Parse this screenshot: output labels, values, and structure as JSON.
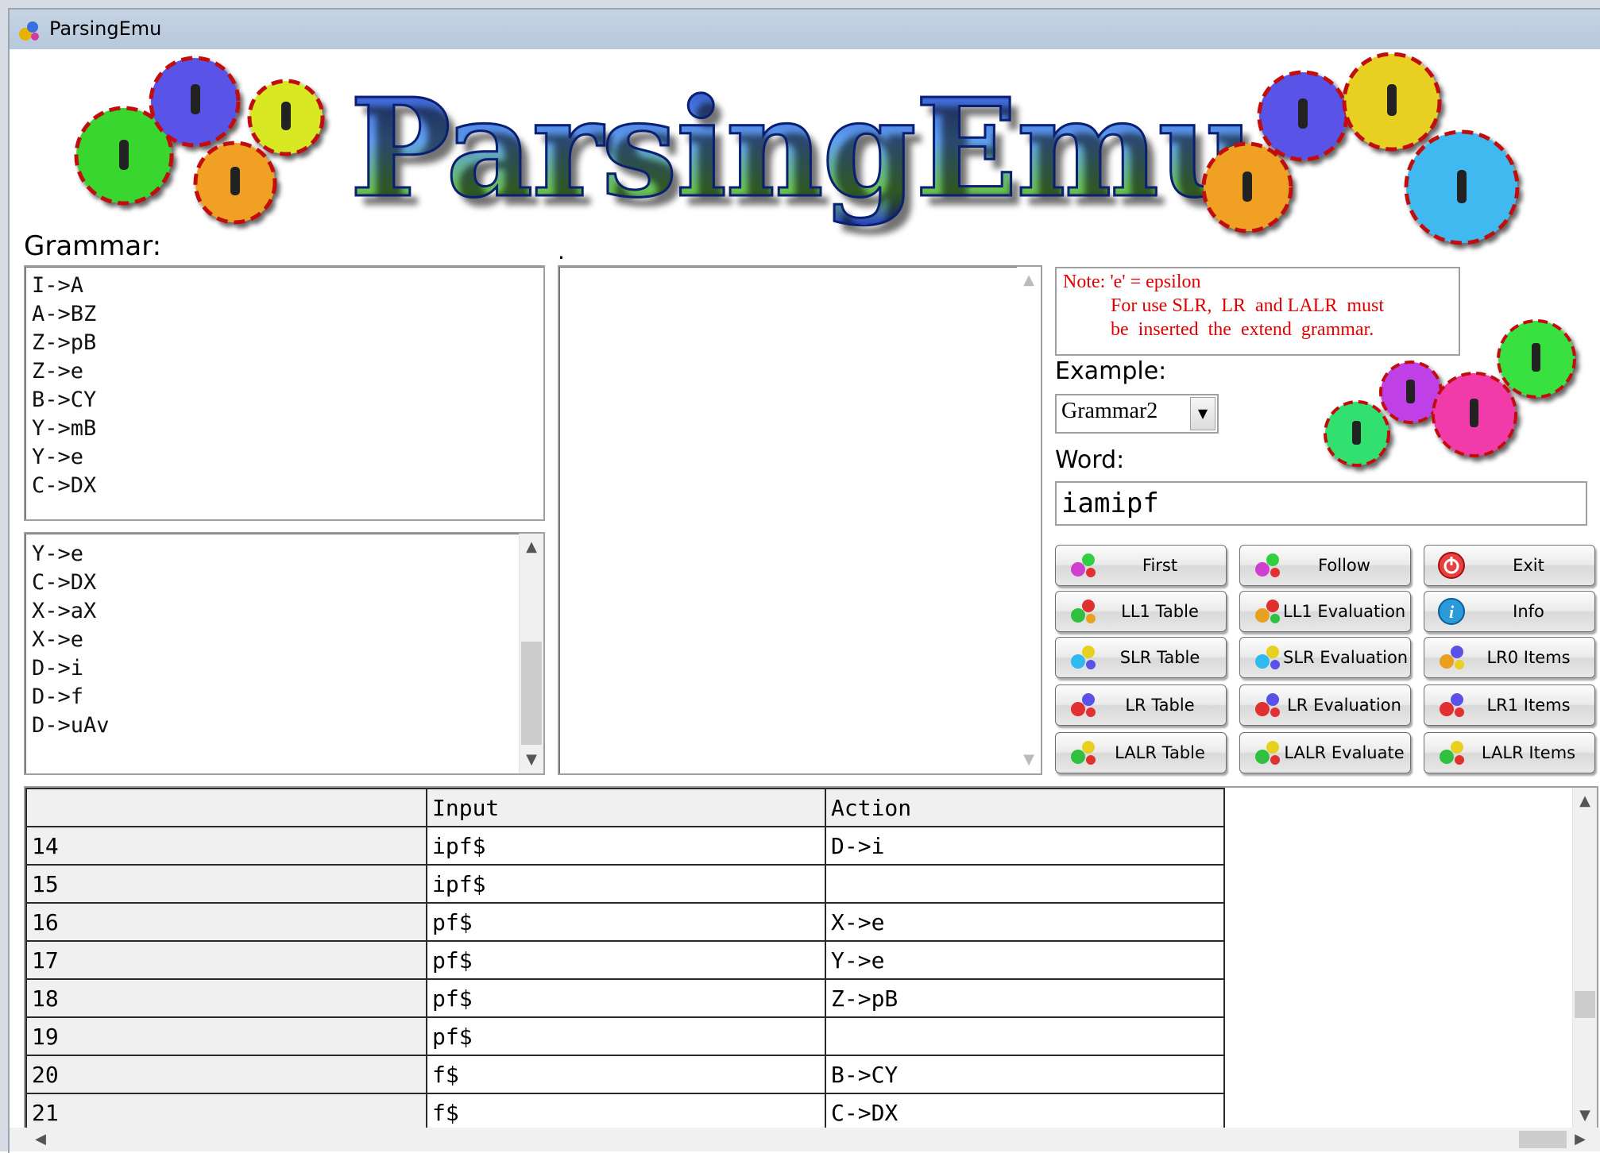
{
  "window": {
    "title": "ParsingEmu"
  },
  "banner": {
    "title": "ParsingEmu"
  },
  "grammar": {
    "label": "Grammar:",
    "top_lines": [
      "I->A",
      "A->BZ",
      "Z->pB",
      "Z->e",
      "B->CY",
      "Y->mB",
      "Y->e",
      "C->DX"
    ],
    "bottom_lines": [
      "Y->e",
      "C->DX",
      "X->aX",
      "X->e",
      "D->i",
      "D->f",
      "D->uAv"
    ]
  },
  "middle": {
    "label": "."
  },
  "note": {
    "line1": "Note: 'e' = epsilon",
    "line2": "For use SLR,  LR  and LALR  must",
    "line3": "be  inserted  the  extend  grammar."
  },
  "example": {
    "label": "Example:",
    "value": "Grammar2"
  },
  "word": {
    "label": "Word:",
    "value": "iamipf"
  },
  "buttons": {
    "first": "First",
    "follow": "Follow",
    "exit": "Exit",
    "ll1_table": "LL1 Table",
    "ll1_eval": "LL1 Evaluation",
    "info": "Info",
    "slr_table": "SLR Table",
    "slr_eval": "SLR Evaluation",
    "lr0_items": "LR0 Items",
    "lr_table": "LR Table",
    "lr_eval": "LR Evaluation",
    "lr1_items": "LR1 Items",
    "lalr_table": "LALR Table",
    "lalr_eval": "LALR Evaluate",
    "lalr_items": "LALR Items"
  },
  "table": {
    "headers": [
      "",
      "Input",
      "Action"
    ],
    "rows": [
      [
        "14",
        "ipf$",
        "D->i"
      ],
      [
        "15",
        "ipf$",
        ""
      ],
      [
        "16",
        "pf$",
        "X->e"
      ],
      [
        "17",
        "pf$",
        "Y->e"
      ],
      [
        "18",
        "pf$",
        "Z->pB"
      ],
      [
        "19",
        "pf$",
        ""
      ],
      [
        "20",
        "f$",
        "B->CY"
      ],
      [
        "21",
        "f$",
        "C->DX"
      ]
    ]
  },
  "colors": {
    "note_text": "#e00000",
    "title_blue": "#3b5fd8",
    "titlebar": "#c6d4e4"
  },
  "icons": {
    "app": "gears-icon",
    "exit": "power-icon",
    "info": "info-icon",
    "buttons": "gears-icon"
  }
}
